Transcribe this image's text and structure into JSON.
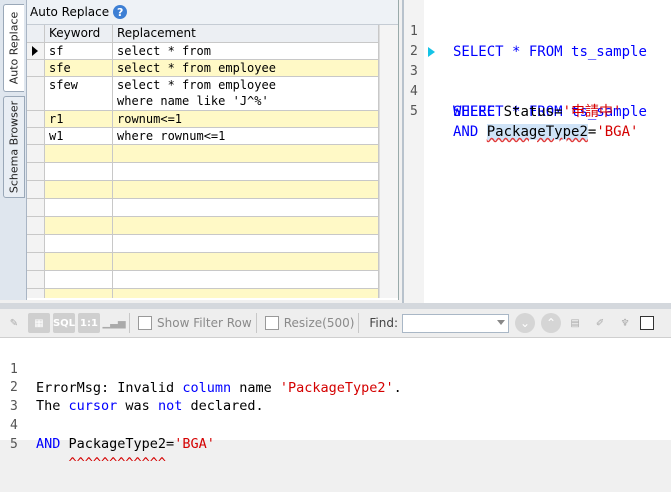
{
  "side_tabs": {
    "auto_replace": "Auto Replace",
    "schema_browser": "Schema Browser"
  },
  "auto_replace": {
    "title": "Auto Replace",
    "help_icon": "help-icon",
    "columns": {
      "keyword": "Keyword",
      "replacement": "Replacement"
    },
    "rows": [
      {
        "keyword": "sf",
        "replacement": "select * from"
      },
      {
        "keyword": "sfe",
        "replacement": "select * from employee"
      },
      {
        "keyword": "sfew",
        "replacement": "select * from employee\nwhere name like 'J^%'"
      },
      {
        "keyword": "r1",
        "replacement": "rownum<=1"
      },
      {
        "keyword": "w1",
        "replacement": "where rownum<=1"
      }
    ]
  },
  "editor": {
    "line_numbers": [
      "1",
      "2",
      "3",
      "4",
      "5"
    ],
    "line1": {
      "kw1": "SELECT",
      "mid": " * ",
      "kw2": "FROM",
      "ident": " ts_sample"
    },
    "line3": {
      "kw1": "SELECT",
      "mid": " * ",
      "kw2": "FROM",
      "ident": " ts_sample"
    },
    "line4": {
      "kw": "WHERE",
      "ident": " Status=",
      "str": "'申請中'"
    },
    "line5": {
      "kw": "AND",
      "sp": " ",
      "ident": "PackageType2",
      "eq": "=",
      "str": "'BGA'"
    }
  },
  "toolbar": {
    "show_filter_row": "Show Filter Row",
    "resize": "Resize(500)",
    "find_label": "Find:",
    "sql_icon_text": "SQL",
    "one_to_one_text": "1:1"
  },
  "messages": {
    "line_numbers": [
      "1",
      "2",
      "3",
      "4",
      "5"
    ],
    "line1": {
      "a": "ErrorMsg: Invalid ",
      "b": "column",
      "c": " name ",
      "d": "'PackageType2'",
      "e": "."
    },
    "line2": {
      "a": "The ",
      "b": "cursor",
      "c": " was ",
      "d": "not",
      "e": " declared."
    },
    "line4": {
      "a": "AND",
      "b": " PackageType2=",
      "c": "'BGA'"
    },
    "line5": {
      "caret": "    ^^^^^^^^^^^^"
    }
  },
  "colors": {
    "keyword": "#0000ff",
    "string": "#d40000",
    "row_highlight": "#fff9c6",
    "current_line_marker": "#14c3e6"
  }
}
